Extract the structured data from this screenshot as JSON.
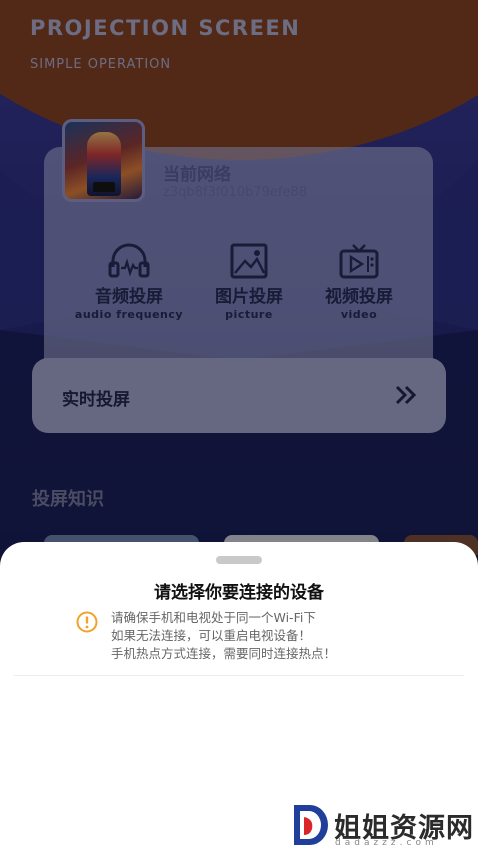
{
  "header": {
    "title": "PROJECTION SCREEN",
    "subtitle": "SIMPLE OPERATION"
  },
  "network": {
    "label": "当前网络",
    "id": "z3qb8f3f010b79efe88"
  },
  "functions": [
    {
      "zh": "音频投屏",
      "en": "audio frequency",
      "icon": "audio-headphones-icon"
    },
    {
      "zh": "图片投屏",
      "en": "picture",
      "icon": "picture-icon"
    },
    {
      "zh": "视频投屏",
      "en": "video",
      "icon": "video-tv-icon"
    }
  ],
  "live": {
    "label": "实时投屏",
    "icon": "double-chevron-right-icon"
  },
  "knowledge": {
    "title": "投屏知识"
  },
  "sheet": {
    "title": "请选择你要连接的设备",
    "notice": [
      "请确保手机和电视处于同一个Wi-Fi下",
      "如果无法连接，可以重启电视设备！",
      "手机热点方式连接，需要同时连接热点！"
    ],
    "warning_icon": "warning-circle-icon",
    "warning_color": "#f0a22a"
  },
  "watermark": {
    "text": "姐姐资源网",
    "domain": "dadazzz.com"
  },
  "colors": {
    "accent_orange": "#7e3e22",
    "background_indigo": "#242873",
    "card": "#aaacd6"
  }
}
